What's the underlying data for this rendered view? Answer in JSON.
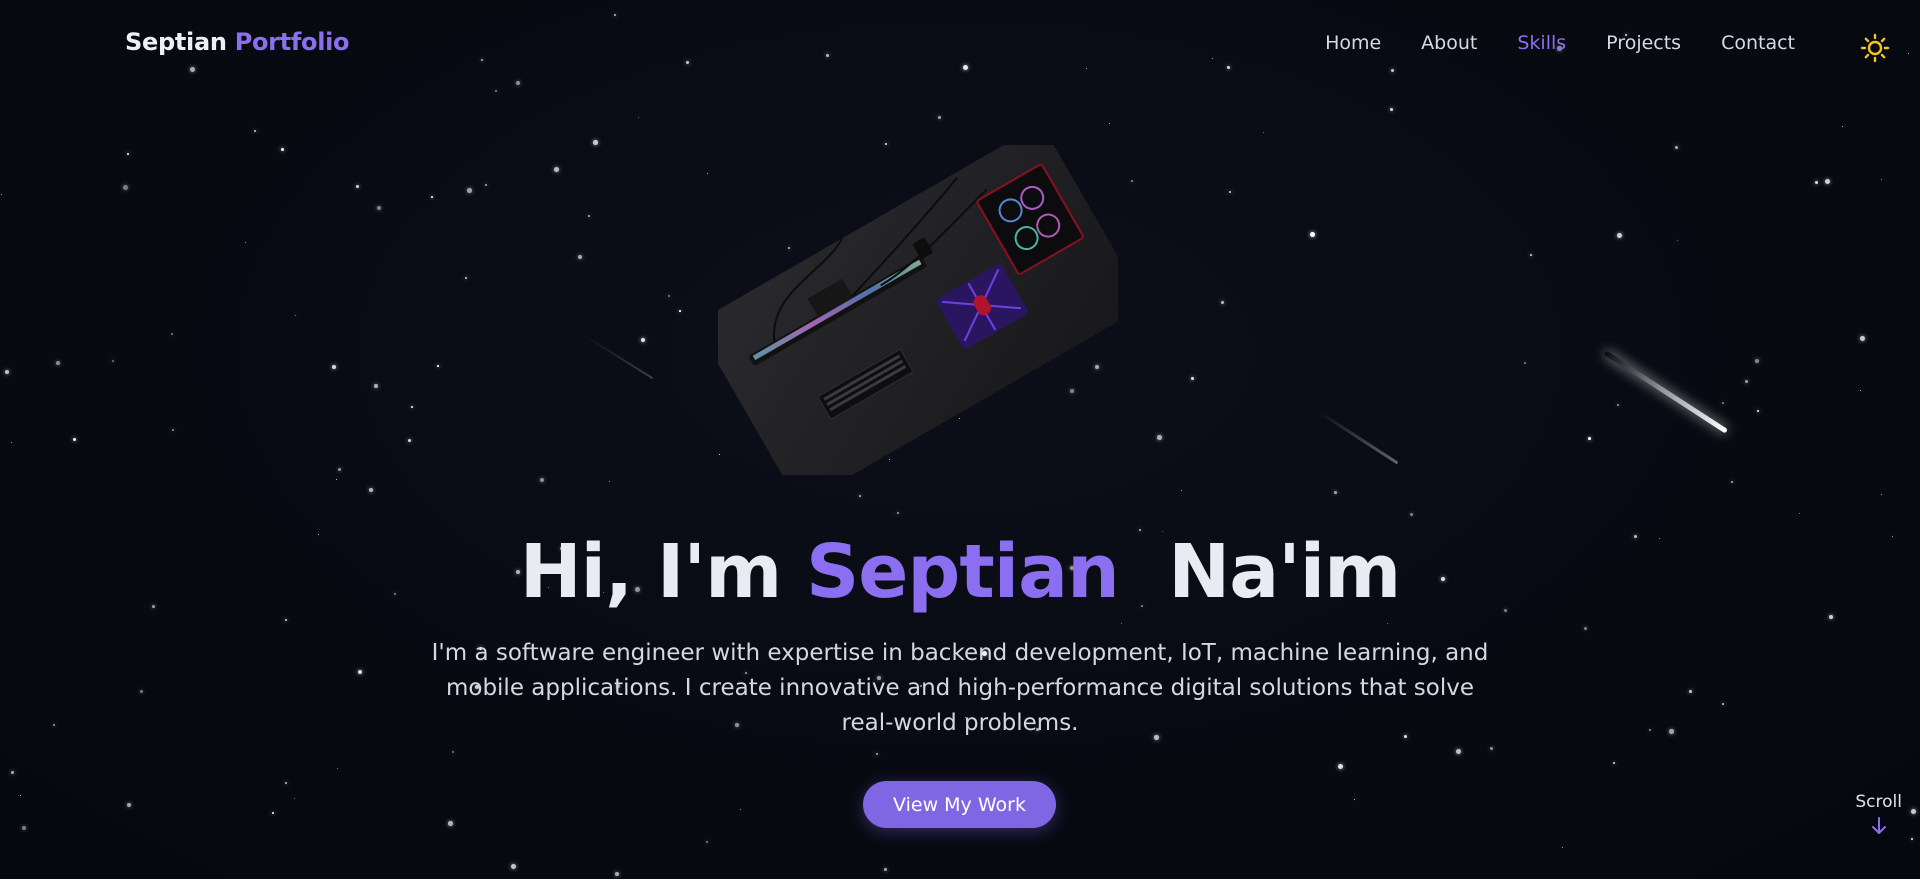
{
  "brand": {
    "first": "Septian",
    "second": "Portfolio"
  },
  "nav": {
    "items": [
      {
        "label": "Home",
        "active": false
      },
      {
        "label": "About",
        "active": false
      },
      {
        "label": "Skills",
        "active": true
      },
      {
        "label": "Projects",
        "active": false
      },
      {
        "label": "Contact",
        "active": false
      }
    ],
    "theme_toggle_icon": "sun-icon"
  },
  "hero": {
    "greeting": "Hi, I'm",
    "name_first": "Septian",
    "name_last": "Na'im",
    "description": "I'm a software engineer with expertise in backend development, IoT, machine learning, and mobile applications. I create innovative and high-performance digital solutions that solve real-world problems.",
    "cta_label": "View My Work"
  },
  "scroll_hint": {
    "label": "Scroll",
    "icon": "arrow-down-icon"
  },
  "colors": {
    "background": "#080a12",
    "accent": "#8b6ff0",
    "button": "#7f67e4",
    "text": "#e6e8ef",
    "sun": "#f5c518"
  }
}
